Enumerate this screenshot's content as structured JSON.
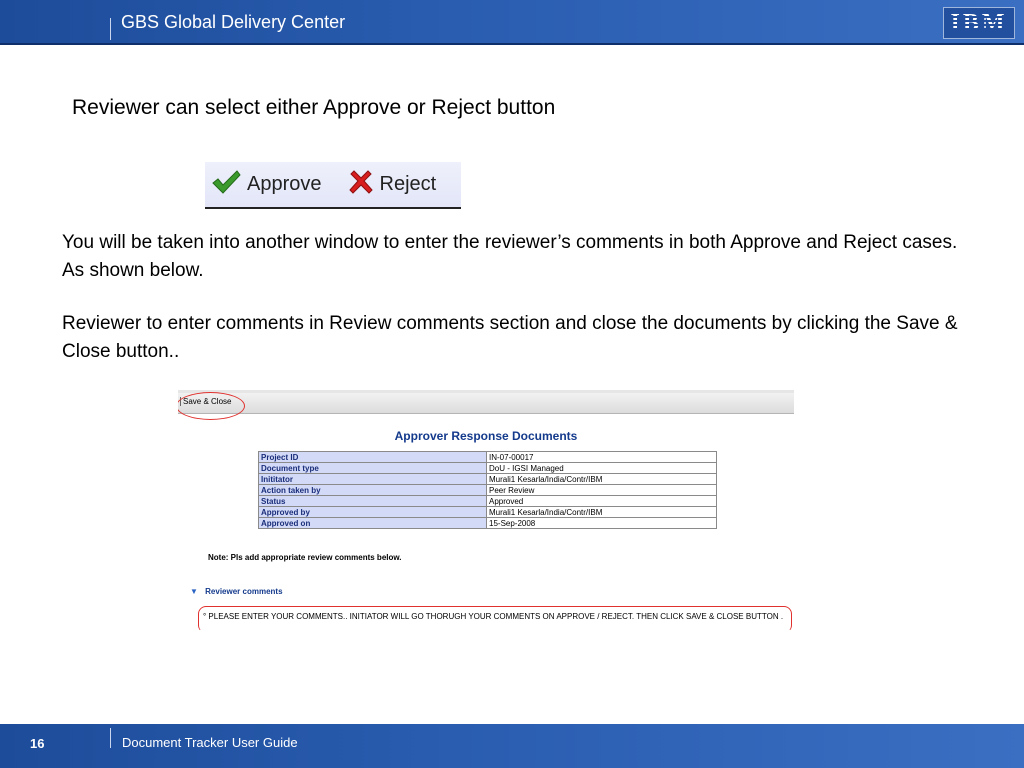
{
  "header": {
    "title": "GBS Global Delivery Center",
    "logo": "IBM"
  },
  "slide": {
    "heading": "Reviewer can select either Approve or Reject button",
    "buttons": {
      "approve": "Approve",
      "reject": "Reject"
    },
    "paragraph1": "You will be taken into another window to enter the reviewer’s comments in both Approve and Reject cases. As shown below.",
    "paragraph2": "Reviewer to enter comments in Review comments section and close the documents by clicking the Save & Close button.."
  },
  "screenshot": {
    "save_close": "Save & Close",
    "title": "Approver Response Documents",
    "rows": [
      {
        "label": "Project ID",
        "value": "IN-07-00017"
      },
      {
        "label": "Document type",
        "value": "DoU - IGSI Managed"
      },
      {
        "label": "Inititator",
        "value": "Murali1 Kesarla/India/Contr/IBM"
      },
      {
        "label": "Action taken by",
        "value": "Peer Review"
      },
      {
        "label": "Status",
        "value": "Approved"
      },
      {
        "label": "Approved by",
        "value": "Murali1 Kesarla/India/Contr/IBM"
      },
      {
        "label": "Approved on",
        "value": "15-Sep-2008"
      }
    ],
    "note": "Note: Pls add appropriate review comments below.",
    "reviewer_comments": "Reviewer comments",
    "comment_text": "° PLEASE ENTER YOUR COMMENTS.. INITIATOR WILL GO THORUGH YOUR COMMENTS ON APPROVE / REJECT. THEN CLICK SAVE & CLOSE BUTTON ."
  },
  "footer": {
    "page_number": "16",
    "guide_title": "Document Tracker User Guide"
  },
  "icons": {
    "approve": "checkmark-icon",
    "reject": "x-icon",
    "collapse": "triangle-down-icon"
  },
  "colors": {
    "brand": "#2a5db0",
    "highlight": "#e0312e",
    "approve_green": "#3a9a2c",
    "reject_red": "#d81e1e"
  }
}
